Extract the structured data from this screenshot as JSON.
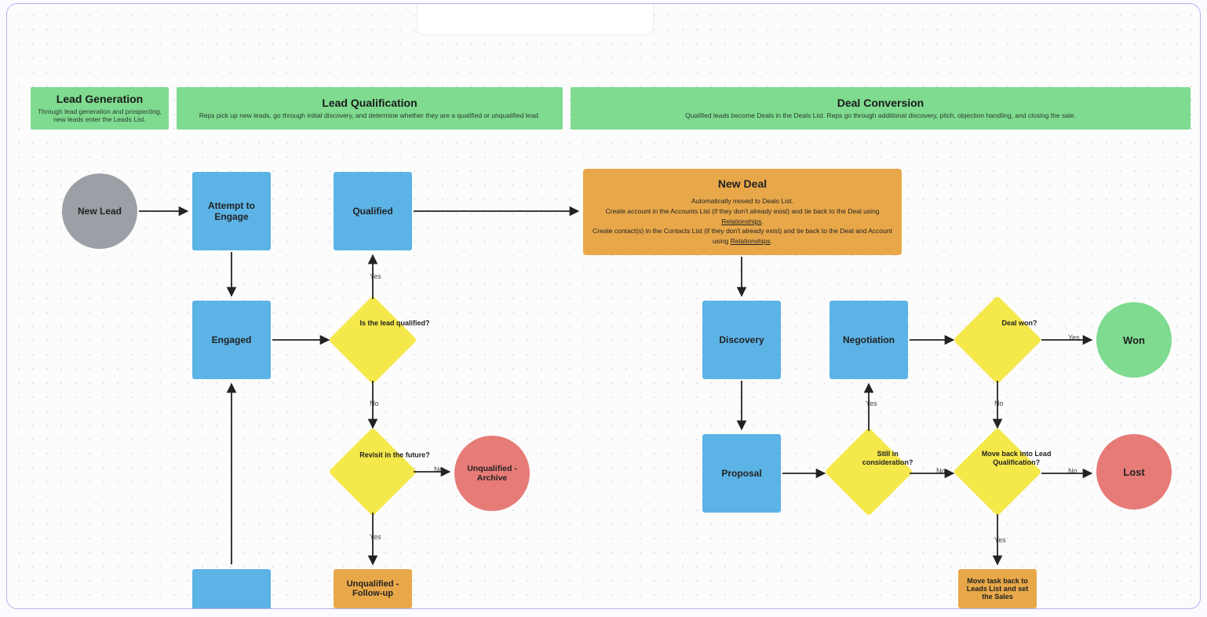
{
  "phases": {
    "lead_gen": {
      "title": "Lead Generation",
      "sub": "Through lead generation and prospecting, new leads enter the Leads List."
    },
    "lead_qual": {
      "title": "Lead Qualification",
      "sub": "Reps pick up new leads, go through initial discovery, and determine whether they are a qualified or unqualified lead."
    },
    "deal_conv": {
      "title": "Deal Conversion",
      "sub": "Qualified leads become Deals in the Deals List. Reps go through additional discovery, pitch, objection handling, and closing the sale."
    }
  },
  "nodes": {
    "new_lead": "New Lead",
    "attempt": "Attempt to Engage",
    "qualified": "Qualified",
    "engaged": "Engaged",
    "is_qualified": "Is the lead qualified?",
    "revisit": "Revisit in the future?",
    "unq_archive": "Unqualified - Archive",
    "unq_follow": "Unqualified - Follow-up",
    "new_deal_title": "New Deal",
    "new_deal_line1": "Automatically moved to Deals List.",
    "new_deal_line2a": "Create account in the Accounts List (if they don't already exist) and tie back to the Deal using ",
    "new_deal_line2b": "Relationships",
    "new_deal_line3a": "Create contact(s) in the Contacts List (if they don't already exist) and tie back to the Deal and Account using ",
    "new_deal_line3b": "Relationships",
    "discovery": "Discovery",
    "negotiation": "Negotiation",
    "deal_won": "Deal won?",
    "won": "Won",
    "proposal": "Proposal",
    "still": "Still in consideration?",
    "move_back": "Move back into Lead Qualification?",
    "lost": "Lost",
    "move_task": "Move task back to Leads List and set the Sales"
  },
  "labels": {
    "yes": "Yes",
    "no": "No"
  },
  "colors": {
    "grey": "#9aa0a5",
    "blue": "#5cb3e6",
    "yellow": "#f5e84a",
    "green_node": "#7edb8f",
    "red": "#e77b77",
    "orange": "#e8a84a"
  }
}
